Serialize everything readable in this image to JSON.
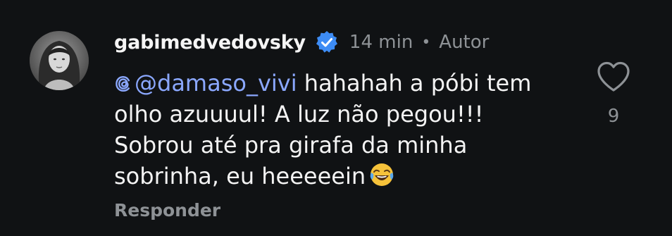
{
  "comment": {
    "username": "gabimedvedovsky",
    "verified_icon": "verified-badge-icon",
    "time": "14 min",
    "separator": "•",
    "author_tag": "Autor",
    "mention": "@damaso_vivi",
    "text": " hahahah a póbi tem olho azuuuul! A luz não pegou!!! Sobrou até pra girafa da minha sobrinha, eu heeeeein",
    "emoji": "😂",
    "reply_label": "Responder",
    "like_count": "9",
    "colors": {
      "background": "#101214",
      "mention": "#8ba8ff",
      "muted": "#8e9296",
      "verified": "#3d8cf5"
    }
  }
}
